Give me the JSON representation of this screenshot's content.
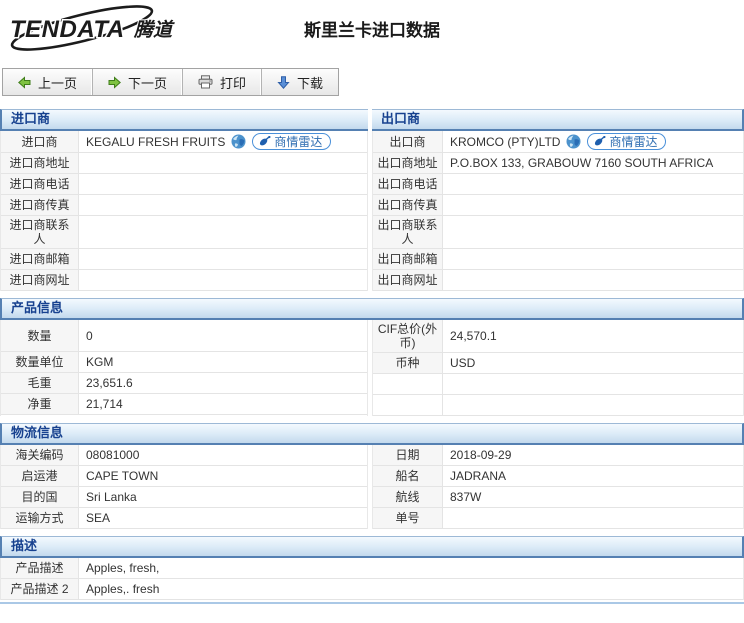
{
  "header": {
    "logo_text": "TENDATA",
    "logo_cn": "腾道",
    "title": "斯里兰卡进口数据"
  },
  "toolbar": {
    "prev_label": "上一页",
    "next_label": "下一页",
    "print_label": "打印",
    "download_label": "下载"
  },
  "radar_badge": {
    "label": "商情雷达"
  },
  "icons": {
    "globe": "globe-icon",
    "radar": "radar-dish-icon",
    "prev": "arrow-left-icon",
    "next": "arrow-right-icon",
    "print": "printer-icon",
    "download": "arrow-down-icon"
  },
  "colors": {
    "section_header_text": "#17418f",
    "section_border_blue": "#5580b2",
    "badge_blue": "#2d6cb0",
    "arrow_green": "#7fc241",
    "arrow_blue": "#5a8fd6",
    "bottom_line_blue": "#aac8e6"
  },
  "sections": {
    "importer": {
      "title": "进口商",
      "rows": [
        {
          "label": "进口商",
          "value": "KEGALU FRESH FRUITS"
        },
        {
          "label": "进口商地址",
          "value": ""
        },
        {
          "label": "进口商电话",
          "value": ""
        },
        {
          "label": "进口商传真",
          "value": ""
        },
        {
          "label": "进口商联系人",
          "value": ""
        },
        {
          "label": "进口商邮箱",
          "value": ""
        },
        {
          "label": "进口商网址",
          "value": ""
        }
      ]
    },
    "exporter": {
      "title": "出口商",
      "rows": [
        {
          "label": "出口商",
          "value": "KROMCO (PTY)LTD"
        },
        {
          "label": "出口商地址",
          "value": "P.O.BOX 133, GRABOUW 7160 SOUTH AFRICA"
        },
        {
          "label": "出口商电话",
          "value": ""
        },
        {
          "label": "出口商传真",
          "value": ""
        },
        {
          "label": "出口商联系人",
          "value": ""
        },
        {
          "label": "出口商邮箱",
          "value": ""
        },
        {
          "label": "出口商网址",
          "value": ""
        }
      ]
    },
    "product": {
      "title": "产品信息",
      "left_rows": [
        {
          "label": "数量",
          "value": "0"
        },
        {
          "label": "数量单位",
          "value": "KGM"
        },
        {
          "label": "毛重",
          "value": "23,651.6"
        },
        {
          "label": "净重",
          "value": "21,714"
        }
      ],
      "right_rows": [
        {
          "label": "CIF总价(外币)",
          "value": "24,570.1"
        },
        {
          "label": "币种",
          "value": "USD"
        },
        {
          "label": "",
          "value": ""
        },
        {
          "label": "",
          "value": ""
        }
      ]
    },
    "logistics": {
      "title": "物流信息",
      "left_rows": [
        {
          "label": "海关编码",
          "value": "08081000"
        },
        {
          "label": "启运港",
          "value": "CAPE TOWN"
        },
        {
          "label": "目的国",
          "value": "Sri Lanka"
        },
        {
          "label": "运输方式",
          "value": "SEA"
        }
      ],
      "right_rows": [
        {
          "label": "日期",
          "value": "2018-09-29"
        },
        {
          "label": "船名",
          "value": "JADRANA"
        },
        {
          "label": "航线",
          "value": "837W"
        },
        {
          "label": "单号",
          "value": ""
        }
      ]
    },
    "description": {
      "title": "描述",
      "rows": [
        {
          "label": "产品描述",
          "value": "Apples, fresh,"
        },
        {
          "label": "产品描述 2",
          "value": "Apples,. fresh"
        }
      ]
    }
  }
}
